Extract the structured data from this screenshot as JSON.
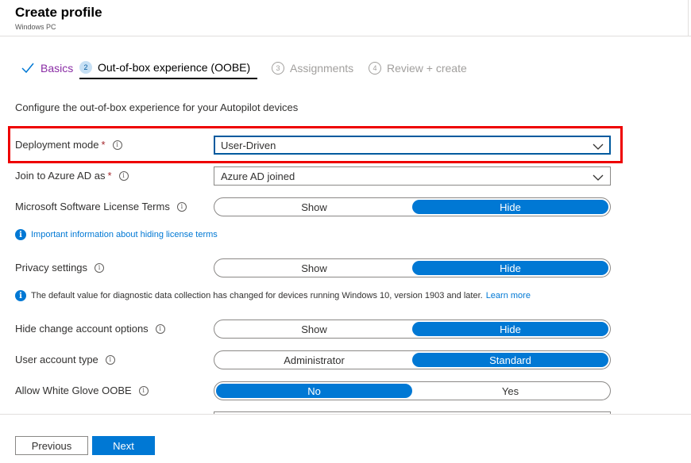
{
  "header": {
    "title": "Create profile",
    "subtitle": "Windows PC"
  },
  "tabs": [
    {
      "label": "Basics",
      "state": "done",
      "icon": "check-icon"
    },
    {
      "num": "2",
      "label": "Out-of-box experience (OOBE)",
      "state": "active"
    },
    {
      "num": "3",
      "label": "Assignments",
      "state": "disabled"
    },
    {
      "num": "4",
      "label": "Review + create",
      "state": "disabled"
    }
  ],
  "intro": "Configure the out-of-box experience for your Autopilot devices",
  "fields": {
    "deployment_mode": {
      "label": "Deployment mode",
      "required": "*",
      "value": "User-Driven"
    },
    "join_azure": {
      "label": "Join to Azure AD as",
      "required": "*",
      "value": "Azure AD joined"
    },
    "license_terms": {
      "label": "Microsoft Software License Terms",
      "options": [
        "Show",
        "Hide"
      ],
      "selected": "Hide"
    },
    "privacy": {
      "label": "Privacy settings",
      "options": [
        "Show",
        "Hide"
      ],
      "selected": "Hide"
    },
    "hide_change_account": {
      "label": "Hide change account options",
      "options": [
        "Show",
        "Hide"
      ],
      "selected": "Hide"
    },
    "user_account_type": {
      "label": "User account type",
      "options": [
        "Administrator",
        "Standard"
      ],
      "selected": "Standard"
    },
    "white_glove": {
      "label": "Allow White Glove OOBE",
      "options": [
        "No",
        "Yes"
      ],
      "selected": "No"
    }
  },
  "notes": {
    "license_link": "Important information about hiding license terms",
    "diagnostic_text": "The default value for diagnostic data collection has changed for devices running Windows 10, version 1903 and later.",
    "diagnostic_link": "Learn more"
  },
  "footer": {
    "previous": "Previous",
    "next": "Next"
  },
  "colors": {
    "accent": "#0078d4",
    "highlight": "#e00000",
    "required": "#a4262c",
    "done_tab": "#8a2da5"
  }
}
